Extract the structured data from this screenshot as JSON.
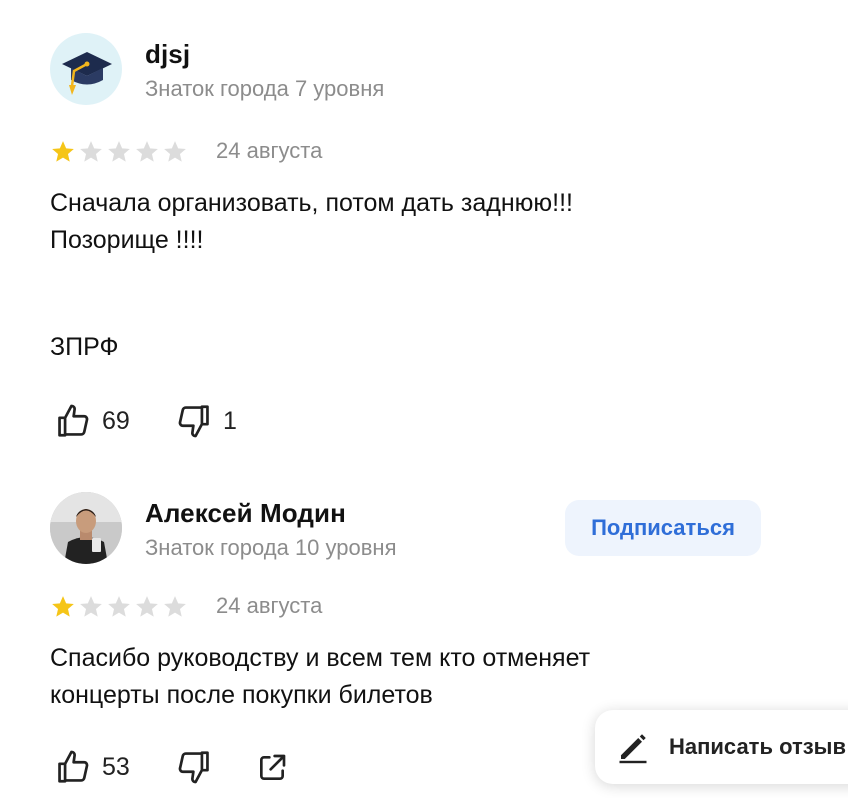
{
  "reviews": [
    {
      "author": "djsj",
      "level": "Знаток города 7 уровня",
      "rating": 1,
      "max_rating": 5,
      "date": "24 августа",
      "text_lines": [
        "Сначала организовать, потом дать заднюю!!!",
        "Позорище !!!!",
        "ЗПРФ"
      ],
      "likes": "69",
      "dislikes": "1",
      "avatar_icon": "graduation-cap-icon"
    },
    {
      "author": "Алексей Модин",
      "level": "Знаток города 10 уровня",
      "subscribe_label": "Подписаться",
      "rating": 1,
      "max_rating": 5,
      "date": "24 августа",
      "text_lines": [
        "Спасибо руководству и всем тем кто отменяет концерты после покупки билетов"
      ],
      "likes": "53",
      "avatar_icon": "user-photo"
    }
  ],
  "write_review_label": "Написать отзыв",
  "colors": {
    "star_filled": "#f5c518",
    "star_empty": "#dcdcdc",
    "accent_blue": "#2f6ed8",
    "subscribe_bg": "#eef4fd",
    "muted_text": "#8c8c8c"
  }
}
